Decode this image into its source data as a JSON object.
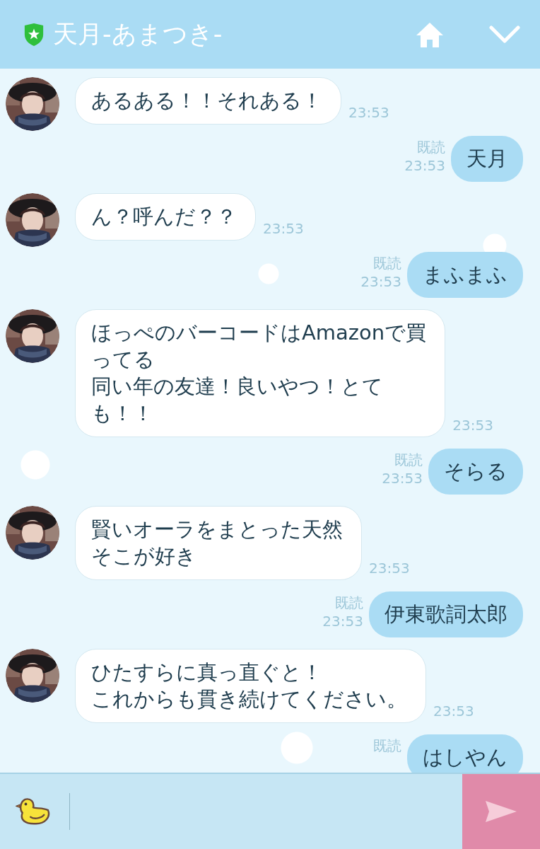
{
  "header": {
    "title": "天月-あまつき-"
  },
  "messages": [
    {
      "kind": "received",
      "lines": [
        "あるある！！それある！"
      ],
      "time": "23:53"
    },
    {
      "kind": "sent",
      "lines": [
        "天月"
      ],
      "read_label": "既読",
      "time": "23:53"
    },
    {
      "kind": "received",
      "lines": [
        "ん？呼んだ？？"
      ],
      "time": "23:53"
    },
    {
      "kind": "sent",
      "lines": [
        "まふまふ"
      ],
      "read_label": "既読",
      "time": "23:53"
    },
    {
      "kind": "received",
      "lines": [
        "ほっぺのバーコードはAmazonで買",
        "ってる",
        "同い年の友達！良いやつ！とて",
        "も！！"
      ],
      "time": "23:53"
    },
    {
      "kind": "sent",
      "lines": [
        "そらる"
      ],
      "read_label": "既読",
      "time": "23:53"
    },
    {
      "kind": "received",
      "lines": [
        "賢いオーラをまとった天然",
        "そこが好き"
      ],
      "time": "23:53"
    },
    {
      "kind": "sent",
      "lines": [
        "伊東歌詞太郎"
      ],
      "read_label": "既読",
      "time": "23:53"
    },
    {
      "kind": "received",
      "lines": [
        "ひたすらに真っ直ぐと！",
        "これからも貫き続けてください。"
      ],
      "time": "23:53"
    },
    {
      "kind": "sent",
      "lines": [
        "はしやん"
      ],
      "read_label": "既読"
    }
  ]
}
